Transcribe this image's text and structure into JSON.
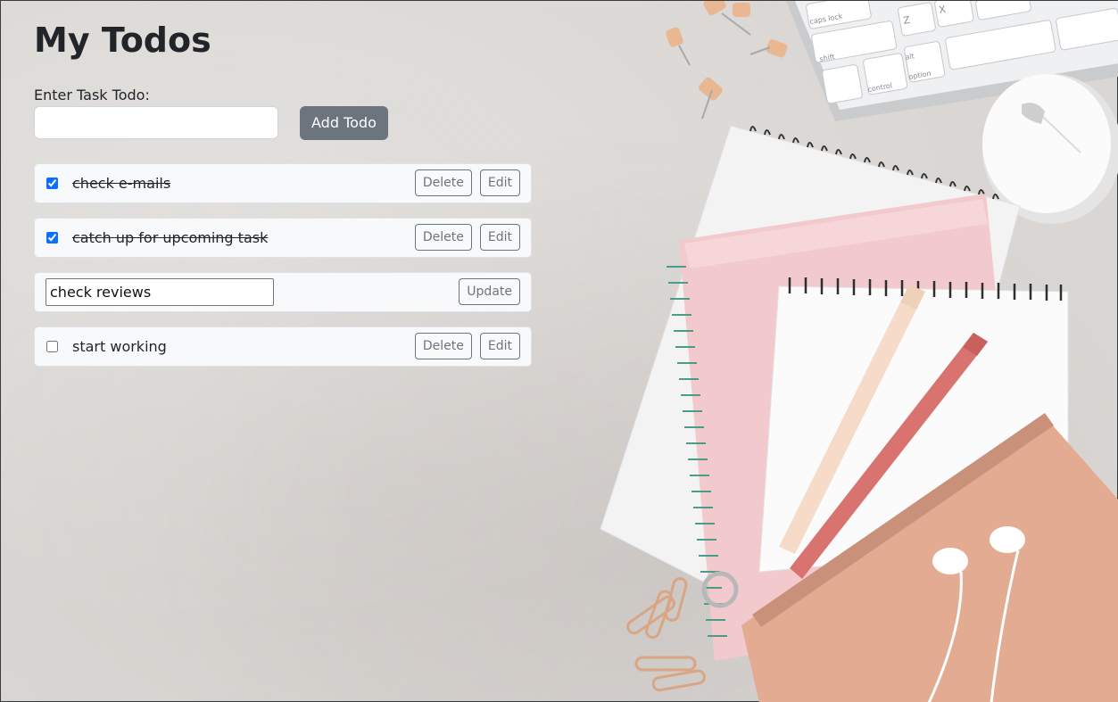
{
  "header": {
    "title": "My Todos"
  },
  "form": {
    "label": "Enter Task Todo:",
    "input_value": "",
    "add_label": "Add Todo"
  },
  "todos": [
    {
      "text": "check e-mails",
      "completed": true,
      "editing": false,
      "delete_label": "Delete",
      "edit_label": "Edit"
    },
    {
      "text": "catch up for upcoming task",
      "completed": true,
      "editing": false,
      "delete_label": "Delete",
      "edit_label": "Edit"
    },
    {
      "text": "check reviews",
      "completed": false,
      "editing": true,
      "update_label": "Update"
    },
    {
      "text": "start working",
      "completed": false,
      "editing": false,
      "delete_label": "Delete",
      "edit_label": "Edit"
    }
  ],
  "keyboard_keys": [
    "caps lock",
    "shift",
    "Z",
    "X",
    "alt",
    "option",
    "control"
  ],
  "colors": {
    "secondary_button": "#6c757d",
    "checkbox_accent": "#0d6efd",
    "item_background": "#f8f9fa"
  }
}
